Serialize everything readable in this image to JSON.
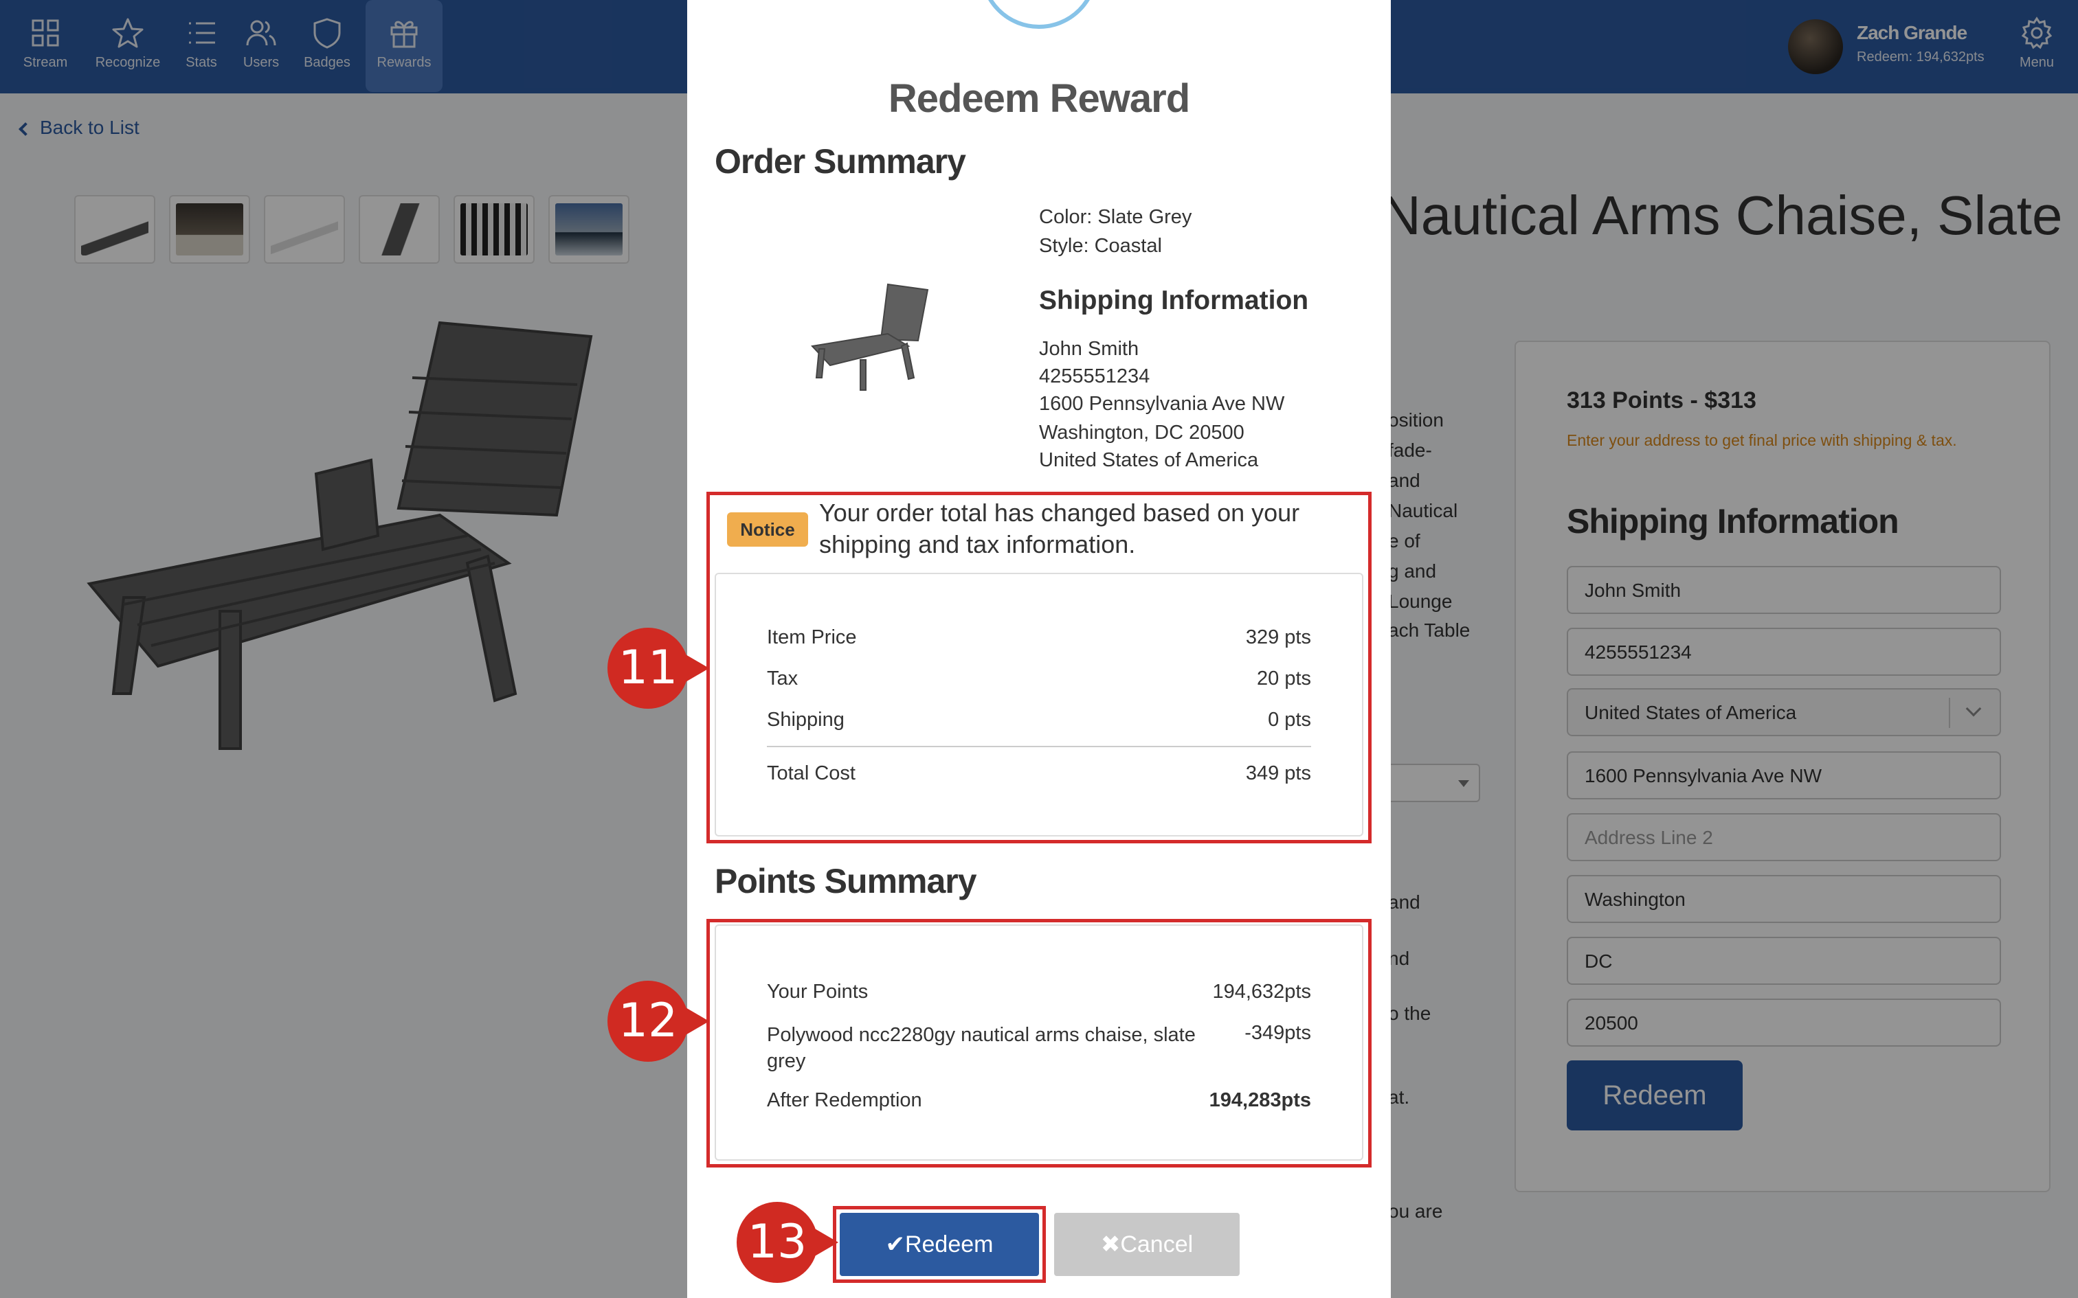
{
  "nav": {
    "items": [
      {
        "label": "Stream",
        "icon": "grid-icon"
      },
      {
        "label": "Recognize",
        "icon": "star-icon"
      },
      {
        "label": "Stats",
        "icon": "list-icon"
      },
      {
        "label": "Users",
        "icon": "users-icon"
      },
      {
        "label": "Badges",
        "icon": "shield-icon"
      },
      {
        "label": "Rewards",
        "icon": "gift-icon"
      }
    ],
    "active": "Rewards",
    "user_name": "Zach Grande",
    "user_points": "Redeem: 194,632pts",
    "menu_label": "Menu"
  },
  "page": {
    "back_label": "Back to List",
    "product_title": "Nautical Arms Chaise, Slate",
    "desc_fragments": [
      "osition",
      "fade-",
      "and",
      "Nautical",
      "e of",
      "g and",
      "Lounge",
      "ach Table",
      "and",
      "nd",
      "o the",
      "at.",
      "ou are"
    ]
  },
  "sidecard": {
    "price": "313 Points - $313",
    "note": "Enter your address to get final price with shipping & tax.",
    "shipping_heading": "Shipping Information",
    "fields": [
      {
        "value": "John Smith",
        "placeholder": ""
      },
      {
        "value": "4255551234",
        "placeholder": ""
      },
      {
        "value": "United States of America",
        "placeholder": "",
        "select": true
      },
      {
        "value": "1600 Pennsylvania Ave NW",
        "placeholder": ""
      },
      {
        "value": "",
        "placeholder": "Address Line 2"
      },
      {
        "value": "Washington",
        "placeholder": ""
      },
      {
        "value": "DC",
        "placeholder": ""
      },
      {
        "value": "20500",
        "placeholder": ""
      }
    ],
    "redeem_label": "Redeem"
  },
  "modal": {
    "title": "Redeem Reward",
    "order_summary_heading": "Order Summary",
    "color": "Color: Slate Grey",
    "style": "Style: Coastal",
    "shipping_heading": "Shipping Information",
    "ship_lines": [
      "John Smith",
      "4255551234",
      "1600 Pennsylvania Ave NW",
      "Washington, DC 20500",
      "United States of America"
    ],
    "notice_badge": "Notice",
    "notice_text": "Your order total has changed based on your shipping and tax information.",
    "costs": [
      {
        "label": "Item Price",
        "value": "329 pts"
      },
      {
        "label": "Tax",
        "value": "20 pts"
      },
      {
        "label": "Shipping",
        "value": "0 pts"
      },
      {
        "label": "Total Cost",
        "value": "349 pts"
      }
    ],
    "points_summary_heading": "Points Summary",
    "points": [
      {
        "label": "Your Points",
        "value": "194,632pts"
      },
      {
        "label": "Polywood ncc2280gy nautical arms chaise, slate grey",
        "value": "-349pts"
      },
      {
        "label": "After Redemption",
        "value": "194,283pts"
      }
    ],
    "redeem_label": "✔Redeem",
    "cancel_label": "✖Cancel"
  },
  "callouts": [
    "11",
    "12",
    "13"
  ],
  "colors": {
    "nav": "#2c5aa0",
    "accent_red": "#d42b2b",
    "notice": "#f0ad4e",
    "note_orange": "#d9891c"
  }
}
